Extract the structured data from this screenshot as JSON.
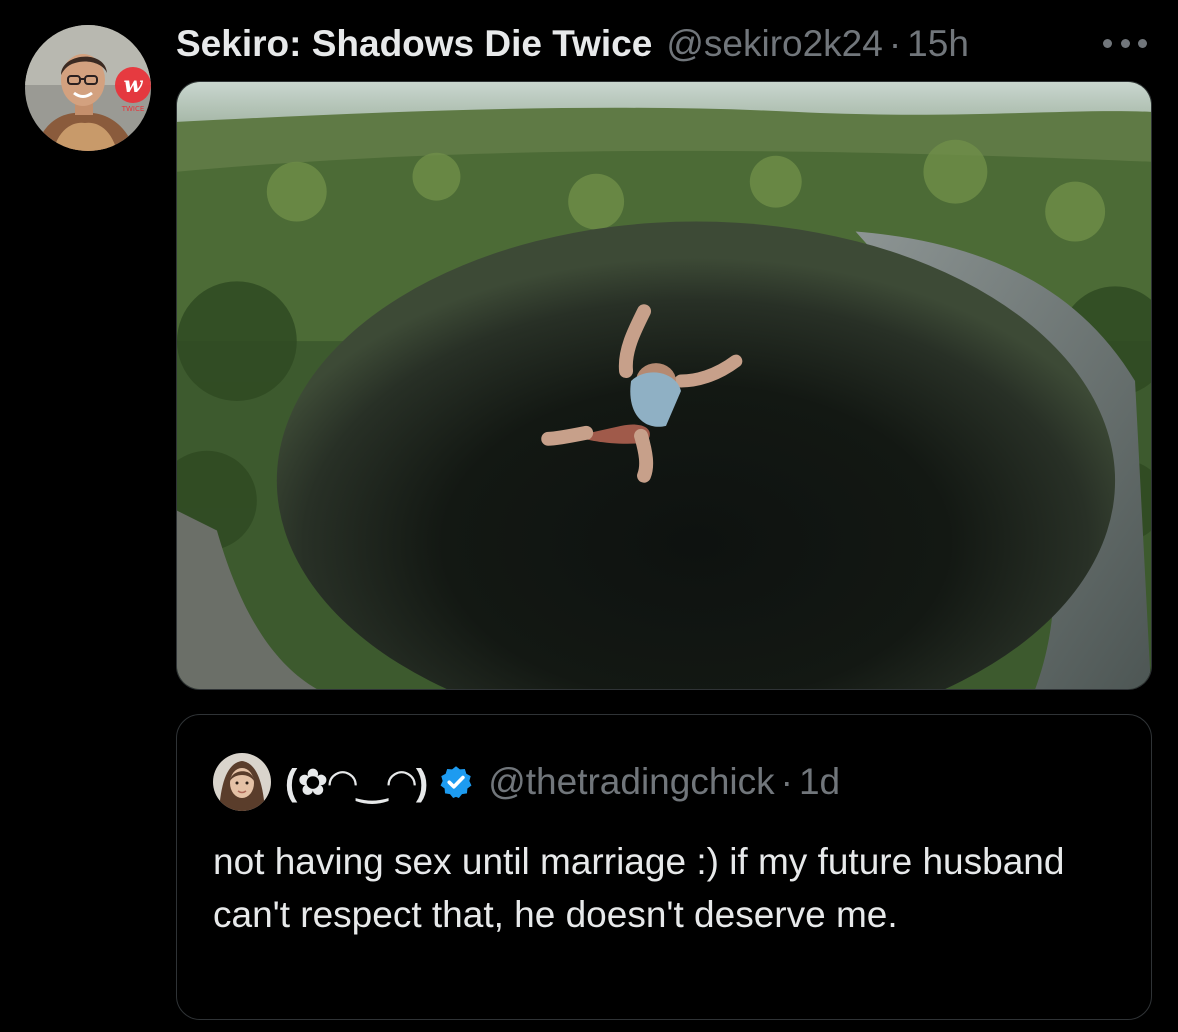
{
  "tweet": {
    "display_name": "Sekiro: Shadows Die Twice",
    "handle": "@sekiro2k24",
    "separator": "·",
    "time": "15h",
    "avatar_icon": "profile-avatar-with-twice-logo",
    "more_icon": "more-options-icon",
    "media_description_icon": "photo-person-jumping-into-sinkhole"
  },
  "quoted_tweet": {
    "display_name": "(✿◠‿◠)",
    "verified_icon": "verified-badge-icon",
    "handle": "@thetradingchick",
    "separator": "·",
    "time": "1d",
    "text": "not having sex until marriage :) if my future husband can't respect that, he doesn't deserve me."
  },
  "colors": {
    "background": "#000000",
    "text_primary": "#e7e9ea",
    "text_secondary": "#71767b",
    "border": "#2f3336",
    "verified_blue": "#1d9bf0",
    "logo_red": "#e8333a"
  }
}
